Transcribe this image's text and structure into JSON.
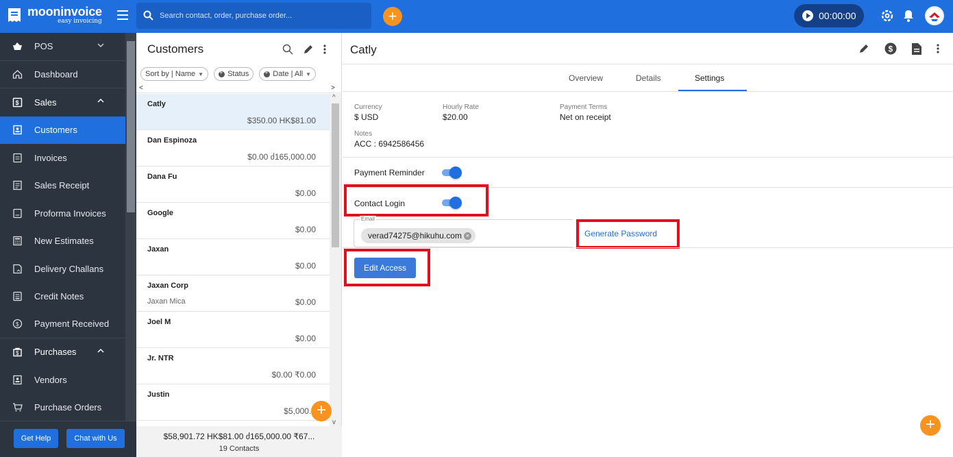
{
  "app": {
    "brand_name": "mooninvoice",
    "brand_tagline": "easy invoicing",
    "search_placeholder": "Search contact, order, purchase order...",
    "add_label": "+",
    "timer": "00:00:00",
    "accent_color": "#1f6fde",
    "orange_color": "#f7931e"
  },
  "sidebar": {
    "items": [
      {
        "label": "POS",
        "icon": "basket-icon"
      },
      {
        "label": "Dashboard",
        "icon": "home-icon"
      },
      {
        "label": "Sales",
        "icon": "dollar-doc-icon"
      },
      {
        "label": "Customers",
        "icon": "contacts-icon"
      },
      {
        "label": "Invoices",
        "icon": "invoice-icon"
      },
      {
        "label": "Sales Receipt",
        "icon": "receipt-icon"
      },
      {
        "label": "Proforma Invoices",
        "icon": "proforma-icon"
      },
      {
        "label": "New Estimates",
        "icon": "calculator-icon"
      },
      {
        "label": "Delivery Challans",
        "icon": "delivery-icon"
      },
      {
        "label": "Credit Notes",
        "icon": "credit-note-icon"
      },
      {
        "label": "Payment Received",
        "icon": "payment-icon"
      },
      {
        "label": "Purchases",
        "icon": "purchase-icon"
      },
      {
        "label": "Vendors",
        "icon": "vendor-icon"
      },
      {
        "label": "Purchase Orders",
        "icon": "cart-icon"
      }
    ],
    "help_label": "Get Help",
    "chat_label": "Chat with Us"
  },
  "customers": {
    "title": "Customers",
    "filters": {
      "sort": "Sort by | Name",
      "status": "Status",
      "date": "Date | All"
    },
    "rows": [
      {
        "name": "Catly",
        "sub": "",
        "amount": "$350.00 HK$81.00"
      },
      {
        "name": "Dan Espinoza",
        "sub": "",
        "amount": "$0.00 ძ165,000.00"
      },
      {
        "name": "Dana Fu",
        "sub": "",
        "amount": "$0.00"
      },
      {
        "name": "Google",
        "sub": "",
        "amount": "$0.00"
      },
      {
        "name": "Jaxan",
        "sub": "",
        "amount": "$0.00"
      },
      {
        "name": "Jaxan Corp",
        "sub": "Jaxan Mica",
        "amount": "$0.00"
      },
      {
        "name": "Joel M",
        "sub": "",
        "amount": "$0.00"
      },
      {
        "name": "Jr. NTR",
        "sub": "",
        "amount": "$0.00 ₹0.00"
      },
      {
        "name": "Justin",
        "sub": "",
        "amount": "$5,000.0"
      }
    ],
    "totals": "$58,901.72 HK$81.00 ძ165,000.00 ₹67...",
    "count": "19 Contacts"
  },
  "detail": {
    "title": "Catly",
    "tabs": [
      "Overview",
      "Details",
      "Settings"
    ],
    "active_tab": "Settings",
    "currency_label": "Currency",
    "currency_value": "$ USD",
    "rate_label": "Hourly Rate",
    "rate_value": "$20.00",
    "terms_label": "Payment Terms",
    "terms_value": "Net on receipt",
    "notes_label": "Notes",
    "notes_value": "ACC : 6942586456",
    "payment_reminder_label": "Payment Reminder",
    "payment_reminder_on": true,
    "contact_login_label": "Contact Login",
    "contact_login_on": true,
    "email_label": "Email",
    "email_value": "verad74275@hikuhu.com",
    "generate_password": "Generate Password",
    "edit_access": "Edit Access",
    "highlight_color": "#e0101e"
  }
}
